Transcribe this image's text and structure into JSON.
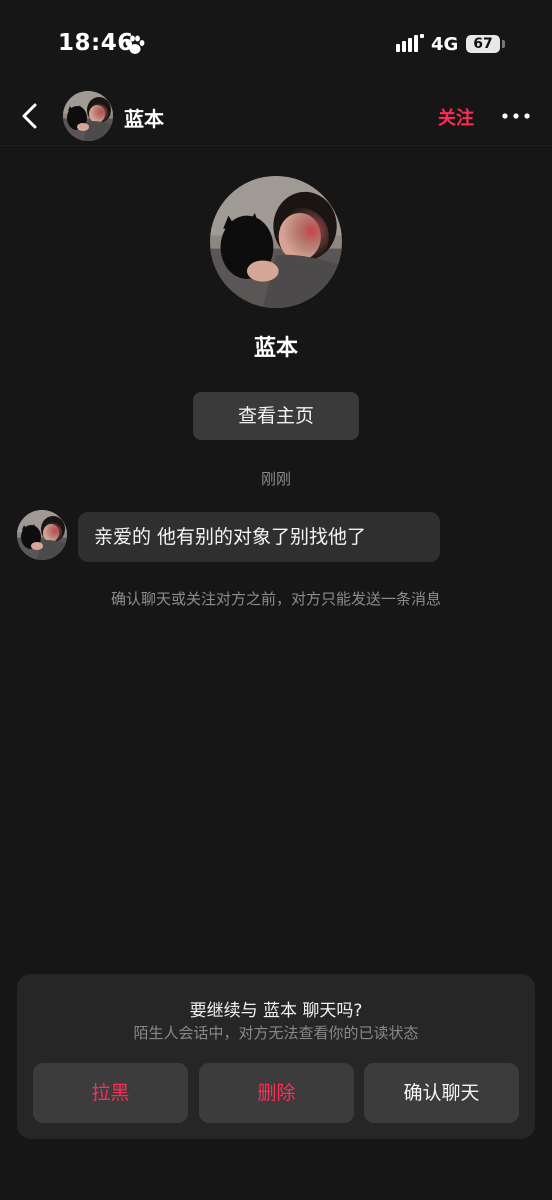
{
  "status_bar": {
    "time": "18:46",
    "network": "4G",
    "battery": "67"
  },
  "header": {
    "name": "蓝本",
    "follow_label": "关注"
  },
  "profile": {
    "name": "蓝本",
    "view_home_label": "查看主页"
  },
  "chat": {
    "timestamp": "刚刚",
    "message": "亲爱的 他有别的对象了别找他了",
    "notice": "确认聊天或关注对方之前，对方只能发送一条消息"
  },
  "panel": {
    "title": "要继续与 蓝本 聊天吗?",
    "subtitle": "陌生人会话中，对方无法查看你的已读状态",
    "buttons": {
      "block": "拉黑",
      "delete": "删除",
      "confirm": "确认聊天"
    }
  },
  "colors": {
    "background": "#161616",
    "accent": "#fe2c55",
    "bubble": "#2f2f2f",
    "panel": "#262626",
    "button": "#3c3c3c"
  },
  "icons": {
    "status": [
      "paw-icon",
      "signal-icon",
      "battery-icon"
    ],
    "header": [
      "back-icon",
      "more-icon"
    ]
  }
}
